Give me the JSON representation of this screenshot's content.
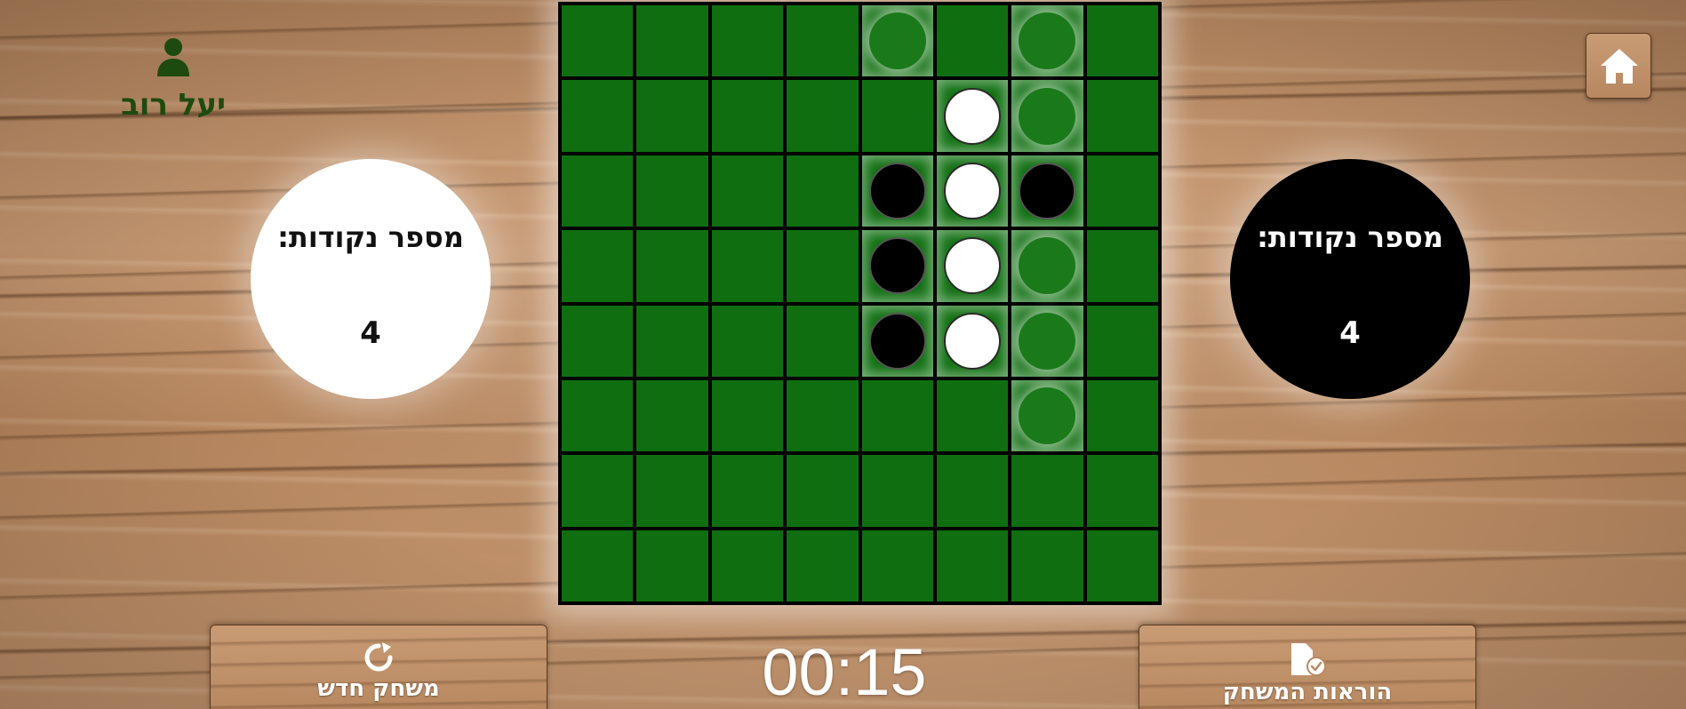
{
  "player": {
    "name": "יעל רוב",
    "icon": "user-icon"
  },
  "scores": {
    "white": {
      "label": "מספר נקודות:",
      "value": "4"
    },
    "black": {
      "label": "מספר נקודות:",
      "value": "4"
    }
  },
  "board": {
    "size": 8,
    "cell_color": "#0f6f10",
    "pieces": [
      {
        "row": 1,
        "col": 5,
        "color": "white"
      },
      {
        "row": 2,
        "col": 4,
        "color": "black"
      },
      {
        "row": 2,
        "col": 5,
        "color": "white"
      },
      {
        "row": 2,
        "col": 6,
        "color": "black"
      },
      {
        "row": 3,
        "col": 4,
        "color": "black"
      },
      {
        "row": 3,
        "col": 5,
        "color": "white"
      },
      {
        "row": 4,
        "col": 4,
        "color": "black"
      },
      {
        "row": 4,
        "col": 5,
        "color": "white"
      }
    ],
    "valid_moves": [
      {
        "row": 0,
        "col": 4
      },
      {
        "row": 0,
        "col": 6
      },
      {
        "row": 1,
        "col": 6
      },
      {
        "row": 3,
        "col": 6
      },
      {
        "row": 4,
        "col": 6
      },
      {
        "row": 5,
        "col": 6
      }
    ]
  },
  "timer": {
    "value": "00:15"
  },
  "buttons": {
    "new_game": {
      "label": "משחק חדש",
      "icon": "refresh-icon"
    },
    "instructions": {
      "label": "הוראות המשחק",
      "icon": "document-check-icon"
    },
    "home": {
      "icon": "home-icon"
    }
  }
}
